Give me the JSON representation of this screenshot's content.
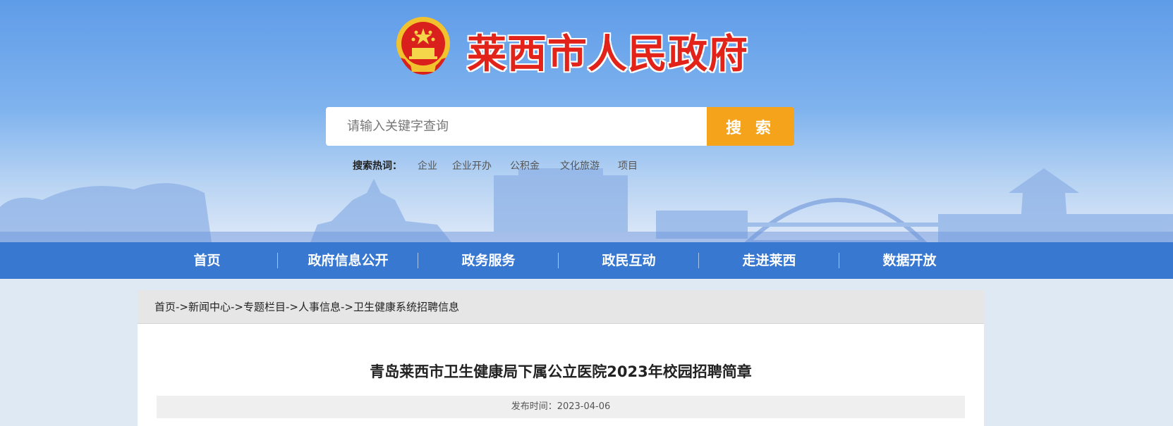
{
  "site": {
    "title": "莱西市人民政府",
    "colors": {
      "title_red": "#e2231a",
      "nav_blue": "#3878d0",
      "search_orange": "#f5a31b"
    },
    "emblem_icon": "national-emblem"
  },
  "search": {
    "placeholder": "请输入关键字查询",
    "value": "",
    "button_label": "搜 索",
    "hot_label": "搜索热词：",
    "hot_words": [
      "企业",
      "企业开办",
      "公积金",
      "文化旅游",
      "项目"
    ]
  },
  "nav": {
    "items": [
      "首页",
      "政府信息公开",
      "政务服务",
      "政民互动",
      "走进莱西",
      "数据开放"
    ]
  },
  "breadcrumb": {
    "items": [
      "首页",
      "新闻中心",
      "专题栏目",
      "人事信息",
      "卫生健康系统招聘信息"
    ],
    "separator": "->"
  },
  "article": {
    "title": "青岛莱西市卫生健康局下属公立医院2023年校园招聘简章",
    "publish_label": "发布时间：",
    "publish_date": "2023-04-06"
  }
}
